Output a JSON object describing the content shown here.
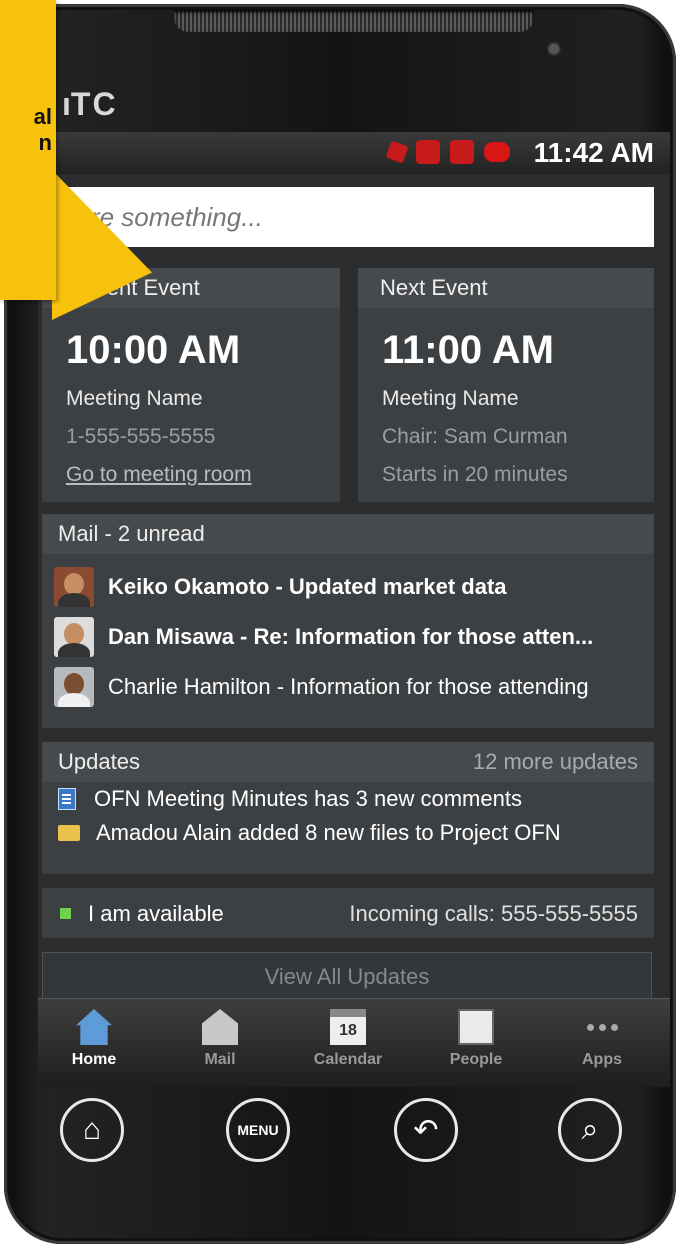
{
  "brand": "TC",
  "statusbar": {
    "time": "11:42 AM"
  },
  "share": {
    "placeholder": "hare something..."
  },
  "current_event": {
    "header": "Current Event",
    "time": "10:00 AM",
    "meeting": "Meeting Name",
    "phone": "1-555-555-5555",
    "link": "Go to meeting room"
  },
  "next_event": {
    "header": "Next Event",
    "time": "11:00 AM",
    "meeting": "Meeting Name",
    "chair": "Chair: Sam Curman",
    "starts": "Starts in 20 minutes"
  },
  "mail": {
    "header": "Mail - 2 unread",
    "items": [
      {
        "text": "Keiko Okamoto - Updated market data",
        "unread": true
      },
      {
        "text": "Dan Misawa - Re: Information for those atten...",
        "unread": true
      },
      {
        "text": "Charlie Hamilton - Information for those attending",
        "unread": false
      }
    ]
  },
  "updates": {
    "header": "Updates",
    "more": "12 more updates",
    "items": [
      {
        "icon": "document-icon",
        "text": "OFN Meeting Minutes has 3 new comments"
      },
      {
        "icon": "folder-icon",
        "text": "Amadou Alain added 8 new files to Project OFN"
      }
    ]
  },
  "availability": {
    "status": "I am available",
    "calls": "Incoming calls: 555-555-5555"
  },
  "view_all": "View All Updates",
  "tabs": [
    {
      "label": "Home",
      "icon": "home-icon"
    },
    {
      "label": "Mail",
      "icon": "mail-icon"
    },
    {
      "label": "Calendar",
      "icon": "calendar-icon",
      "day": "18"
    },
    {
      "label": "People",
      "icon": "people-icon"
    },
    {
      "label": "Apps",
      "icon": "apps-icon"
    }
  ],
  "hardware_buttons": {
    "menu": "MENU"
  },
  "callout": {
    "line1": "al",
    "line2": "n"
  },
  "colors": {
    "callout": "#f7c20c",
    "screen_bg": "#2b2d2f",
    "panel_bg": "#3d4043",
    "available": "#6cd34a"
  }
}
